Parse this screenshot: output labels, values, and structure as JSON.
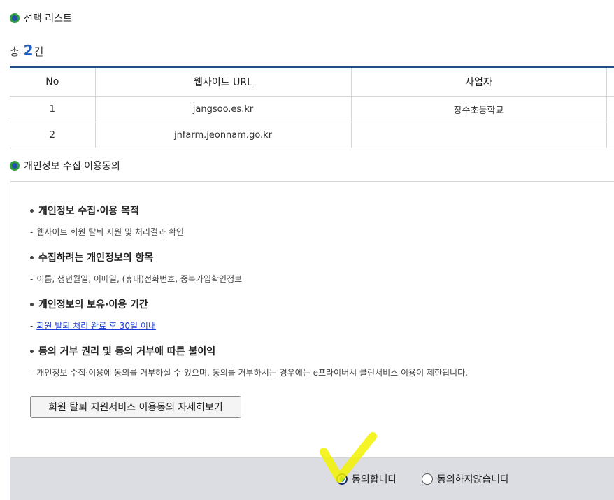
{
  "selection_section": {
    "title": "선택 리스트"
  },
  "total": {
    "prefix": "총",
    "count": "2",
    "suffix": "건"
  },
  "table": {
    "headers": [
      "No",
      "웹사이트 URL",
      "사업자"
    ],
    "rows": [
      {
        "no": "1",
        "url": "jangsoo.es.kr",
        "company": "장수초등학교"
      },
      {
        "no": "2",
        "url": "jnfarm.jeonnam.go.kr",
        "company": ""
      }
    ]
  },
  "consent_section": {
    "title": "개인정보 수집 이용동의",
    "items": [
      {
        "heading": "개인정보 수집·이용 목적",
        "desc": "웹사이트 회원 탈퇴 지원 및 처리결과 확인"
      },
      {
        "heading": "수집하려는 개인정보의 항목",
        "desc": "이름, 생년월일, 이메일, (휴대)전화번호, 중복가입확인정보"
      },
      {
        "heading": "개인정보의 보유·이용 기간",
        "desc": "회원 탈퇴 처리 완료 후 30일 이내"
      },
      {
        "heading": "동의 거부 권리 및 동의 거부에 따른 불이익",
        "desc": "개인정보 수집·이용에 동의를 거부하실 수 있으며, 동의를 거부하시는 경우에는 e프라이버시 클린서비스 이용이 제한됩니다."
      }
    ],
    "detail_button": "회원 탈퇴 지원서비스 이용동의 자세히보기"
  },
  "agree": {
    "agree_label": "동의합니다",
    "disagree_label": "동의하지않습니다",
    "selected": "agree"
  },
  "colors": {
    "title_accent": "#1f5fbf",
    "table_top_border": "#1f4f86",
    "agree_bar_bg": "#dcdde2",
    "annotation_check": "#f2f200"
  }
}
